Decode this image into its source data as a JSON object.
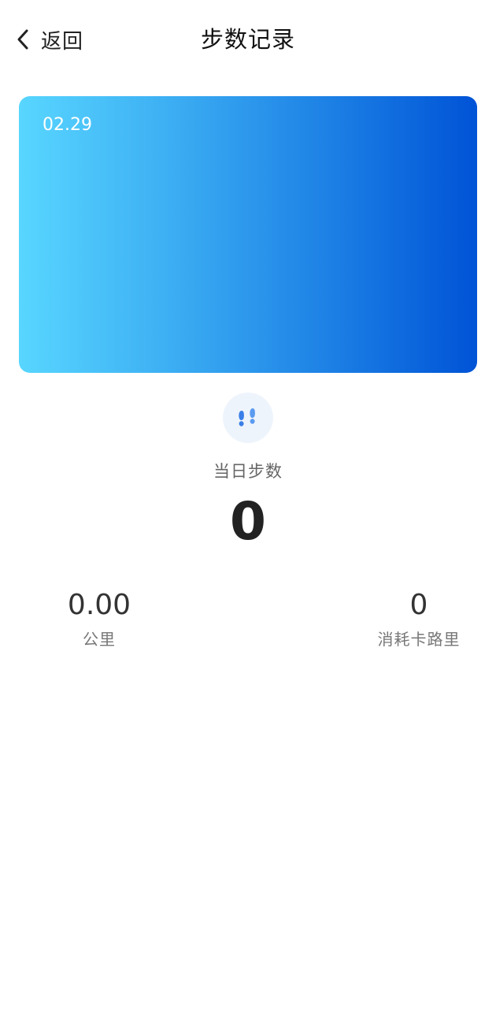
{
  "header": {
    "back_label": "返回",
    "title": "步数记录"
  },
  "card": {
    "date": "02.29",
    "gradient_start": "#58d6ff",
    "gradient_end": "#0053d6"
  },
  "steps": {
    "icon": "footprints-icon",
    "label": "当日步数",
    "value": "0"
  },
  "stats": {
    "distance": {
      "value": "0.00",
      "label": "公里"
    },
    "calories": {
      "value": "0",
      "label": "消耗卡路里"
    }
  }
}
